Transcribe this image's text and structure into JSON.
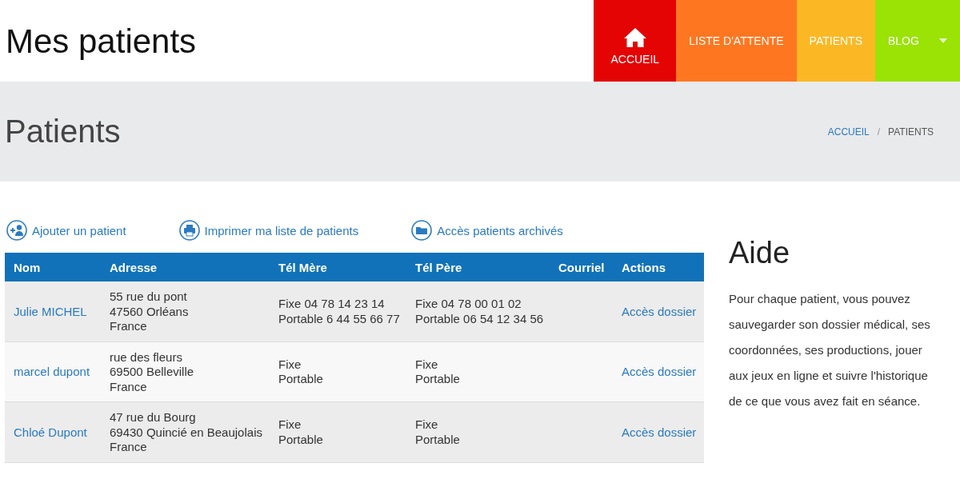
{
  "site_title": "Mes patients",
  "nav": [
    {
      "label": "ACCUEIL",
      "kind": "home",
      "color": "#e40404"
    },
    {
      "label": "LISTE D'ATTENTE",
      "kind": "text",
      "color": "#fe7720"
    },
    {
      "label": "PATIENTS",
      "kind": "text",
      "color": "#fcb824"
    },
    {
      "label": "BLOG",
      "kind": "dropdown",
      "color": "#9ae305"
    }
  ],
  "page_title": "Patients",
  "breadcrumb": [
    {
      "label": "ACCUEIL",
      "kind": "link"
    },
    {
      "label": "/",
      "kind": "separator"
    },
    {
      "label": "PATIENTS",
      "kind": "current"
    }
  ],
  "actions": [
    {
      "label": "Ajouter un patient",
      "kind": "add-person"
    },
    {
      "label": "Imprimer ma liste de patients",
      "kind": "print"
    },
    {
      "label": "Accès patients archivés",
      "kind": "folder"
    }
  ],
  "table": {
    "columns": [
      "Nom",
      "Adresse",
      "Tél Mère",
      "Tél Père",
      "Courriel",
      "Actions"
    ],
    "rows": [
      {
        "name": "Julie MICHEL",
        "address": [
          "55 rue du pont",
          "47560 Orléans",
          "France"
        ],
        "mother": [
          "Fixe 04 78 14 23 14",
          "Portable 6 44 55 66 77"
        ],
        "father": [
          "Fixe 04 78 00 01 02",
          "Portable 06 54 12 34 56"
        ],
        "action": "Accès dossier"
      },
      {
        "name": "marcel dupont",
        "address": [
          "rue des fleurs",
          "69500 Belleville",
          "France"
        ],
        "mother": [
          "Fixe",
          "Portable"
        ],
        "father": [
          "Fixe",
          "Portable"
        ],
        "action": "Accès dossier"
      },
      {
        "name": "Chloé Dupont",
        "address": [
          "47 rue du Bourg",
          "69430 Quincié en Beaujolais",
          "France"
        ],
        "mother": [
          "Fixe",
          "Portable"
        ],
        "father": [
          "Fixe",
          "Portable"
        ],
        "action": "Accès dossier"
      }
    ]
  },
  "help": {
    "title": "Aide",
    "text": "Pour chaque patient, vous pouvez sauvegarder son dossier médical, ses coordonnées, ses productions, jouer aux jeux en ligne et suivre l'historique de ce que vous avez fait en séance."
  }
}
